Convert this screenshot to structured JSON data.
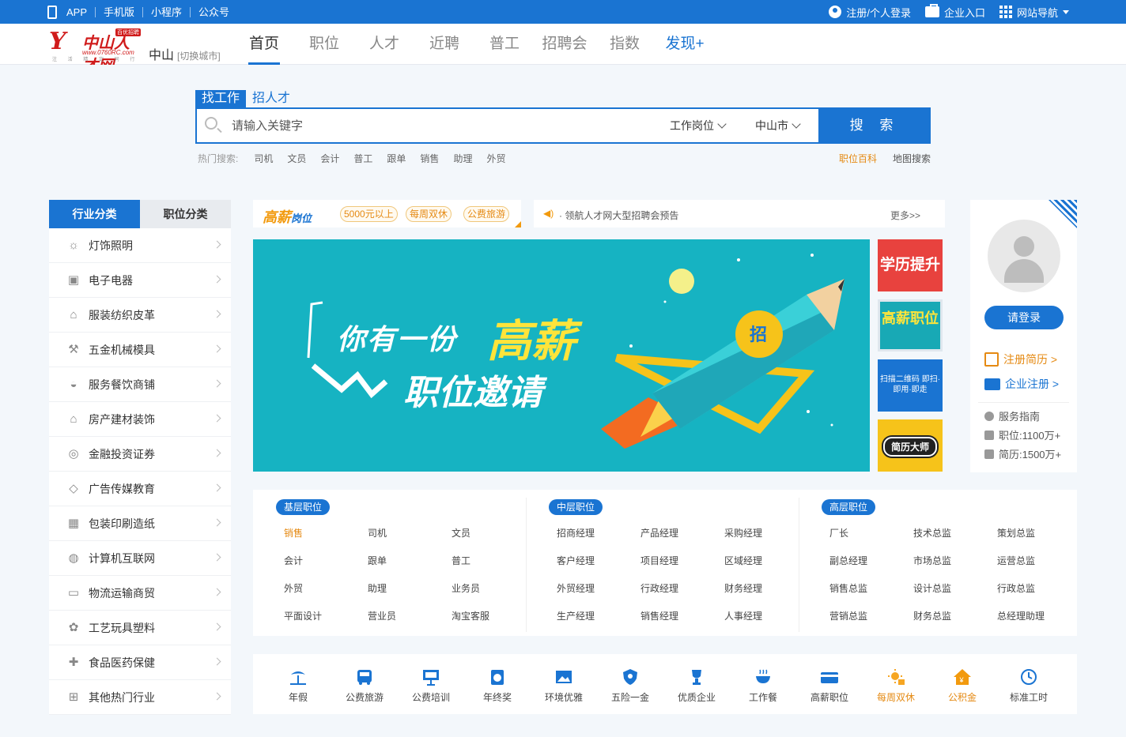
{
  "topbar": {
    "left_links": [
      "APP",
      "手机版",
      "小程序",
      "公众号"
    ],
    "register_login": "注册/个人登录",
    "enterprise": "企业入口",
    "site_nav": "网站导航"
  },
  "logo": {
    "mark": "𝒀",
    "main": "中山人才网",
    "badge": "百优招聘",
    "url": "www.0760RC.com",
    "slogan": "注 活 精 定 同 行"
  },
  "city": {
    "name": "中山",
    "switch": "[切换城市]"
  },
  "nav": [
    "首页",
    "职位",
    "人才",
    "近聘",
    "普工",
    "招聘会",
    "指数",
    "发现+"
  ],
  "search": {
    "tabs": [
      "找工作",
      "招人才"
    ],
    "placeholder": "请输入关键字",
    "type_select": "工作岗位",
    "city_select": "中山市",
    "button": "搜 索",
    "hot_label": "热门搜索:",
    "hot": [
      "司机",
      "文员",
      "会计",
      "普工",
      "跟单",
      "销售",
      "助理",
      "外贸"
    ],
    "job_wiki": "职位百科",
    "map_search": "地图搜索"
  },
  "category": {
    "tabs": [
      "行业分类",
      "职位分类"
    ],
    "items": [
      {
        "icon": "bulb-icon",
        "glyph": "☼",
        "label": "灯饰照明"
      },
      {
        "icon": "tv-icon",
        "glyph": "▣",
        "label": "电子电器"
      },
      {
        "icon": "bag-icon",
        "glyph": "⌂",
        "label": "服装纺织皮革"
      },
      {
        "icon": "wrench-icon",
        "glyph": "⚒",
        "label": "五金机械模具"
      },
      {
        "icon": "dish-icon",
        "glyph": "◒",
        "label": "服务餐饮商铺"
      },
      {
        "icon": "house-icon",
        "glyph": "⌂",
        "label": "房产建材装饰"
      },
      {
        "icon": "coins-icon",
        "glyph": "◎",
        "label": "金融投资证券"
      },
      {
        "icon": "graduation-cap-icon",
        "glyph": "◇",
        "label": "广告传媒教育"
      },
      {
        "icon": "gift-box-icon",
        "glyph": "▦",
        "label": "包装印刷造纸"
      },
      {
        "icon": "globe-icon",
        "glyph": "◍",
        "label": "计算机互联网"
      },
      {
        "icon": "truck-icon",
        "glyph": "▭",
        "label": "物流运输商贸"
      },
      {
        "icon": "flower-icon",
        "glyph": "✿",
        "label": "工艺玩具塑料"
      },
      {
        "icon": "medicine-icon",
        "glyph": "✚",
        "label": "食品医药保健"
      },
      {
        "icon": "hierarchy-icon",
        "glyph": "⊞",
        "label": "其他热门行业"
      }
    ]
  },
  "high_salary": {
    "logo_a": "高薪",
    "logo_b": "岗位",
    "tags": [
      "5000元以上",
      "每周双休",
      "公费旅游"
    ]
  },
  "notice": {
    "text": "· 领航人才网大型招聘会预告",
    "more": "更多>>"
  },
  "banner": {
    "line1": "你有一份",
    "line1_highlight": "高薪",
    "line2": "职位邀请"
  },
  "side_banners": [
    {
      "text": "学历提升"
    },
    {
      "text": "高薪职位"
    },
    {
      "text": "扫描二维码 即扫·即用·即走"
    },
    {
      "text": "简历大师"
    }
  ],
  "user_panel": {
    "login": "请登录",
    "register_resume": "注册简历 >",
    "enterprise_register": "企业注册 >",
    "service_guide": "服务指南",
    "jobs": "职位:1100万+",
    "resumes": "简历:1500万+"
  },
  "levels": [
    {
      "title": "基层职位",
      "jobs": [
        "销售",
        "司机",
        "文员",
        "会计",
        "跟单",
        "普工",
        "外贸",
        "助理",
        "业务员",
        "平面设计",
        "营业员",
        "淘宝客服"
      ]
    },
    {
      "title": "中层职位",
      "jobs": [
        "招商经理",
        "产品经理",
        "采购经理",
        "客户经理",
        "项目经理",
        "区域经理",
        "外贸经理",
        "行政经理",
        "财务经理",
        "生产经理",
        "销售经理",
        "人事经理"
      ]
    },
    {
      "title": "高层职位",
      "jobs": [
        "厂长",
        "技术总监",
        "策划总监",
        "副总经理",
        "市场总监",
        "运营总监",
        "销售总监",
        "设计总监",
        "行政总监",
        "营销总监",
        "财务总监",
        "总经理助理"
      ]
    }
  ],
  "benefits": [
    {
      "icon": "palm-tree-icon",
      "label": "年假"
    },
    {
      "icon": "bus-icon",
      "label": "公费旅游"
    },
    {
      "icon": "presentation-icon",
      "label": "公费培训"
    },
    {
      "icon": "money-icon",
      "label": "年终奖"
    },
    {
      "icon": "picture-icon",
      "label": "环境优雅"
    },
    {
      "icon": "shield-icon",
      "label": "五险一金"
    },
    {
      "icon": "trophy-icon",
      "label": "优质企业"
    },
    {
      "icon": "bowl-icon",
      "label": "工作餐"
    },
    {
      "icon": "card-icon",
      "label": "高薪职位"
    },
    {
      "icon": "sun-icon",
      "label": "每周双休"
    },
    {
      "icon": "home-fund-icon",
      "label": "公积金"
    },
    {
      "icon": "clock-icon",
      "label": "标准工时"
    }
  ],
  "colors": {
    "brand": "#1a74d2",
    "accent": "#e58a13",
    "banner": "#16b3c2"
  }
}
